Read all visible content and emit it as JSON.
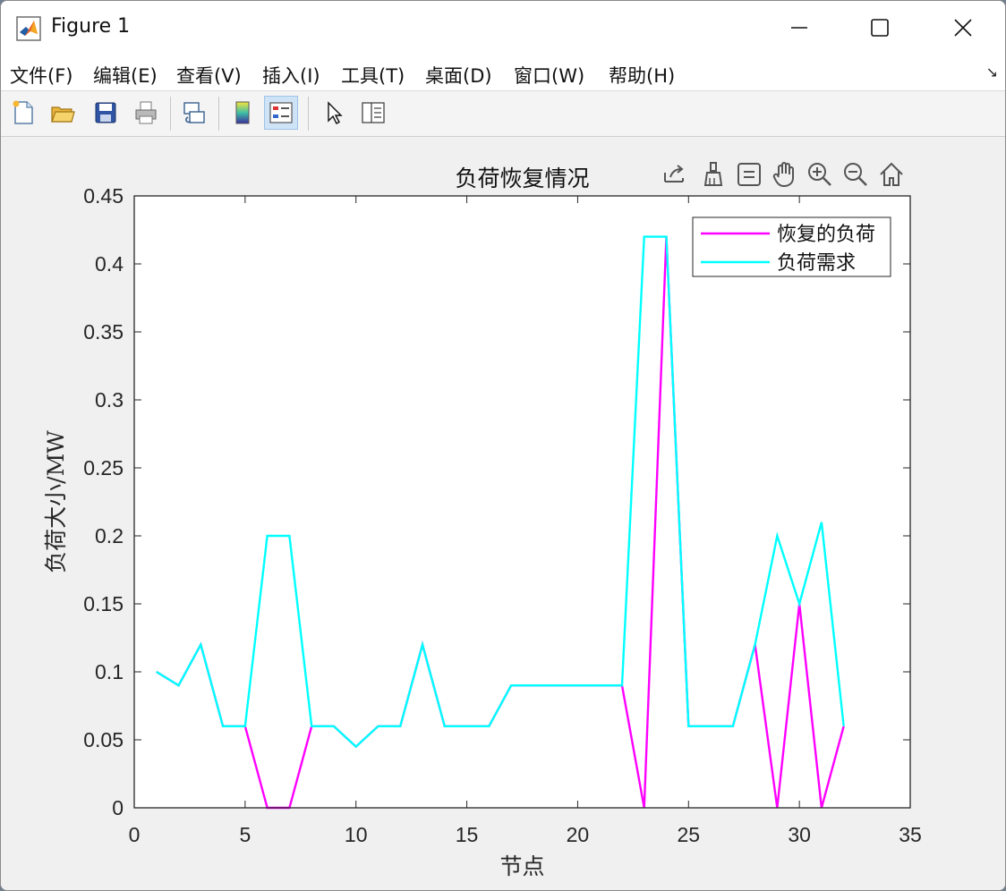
{
  "window": {
    "title": "Figure 1",
    "icon": "matlab-logo-icon"
  },
  "menu": {
    "items": [
      "文件(F)",
      "编辑(E)",
      "查看(V)",
      "插入(I)",
      "工具(T)",
      "桌面(D)",
      "窗口(W)",
      "帮助(H)"
    ],
    "overflow_glyph": "↘"
  },
  "toolbar": {
    "icons": [
      "new-figure-icon",
      "open-file-icon",
      "save-icon",
      "print-icon",
      "link-plot-icon",
      "insert-colorbar-icon",
      "insert-legend-icon",
      "edit-plot-arrow-icon",
      "property-inspector-icon"
    ],
    "active": "insert-legend-icon"
  },
  "axes_toolbar": {
    "icons": [
      "export-icon",
      "brush-icon",
      "data-tips-icon",
      "pan-icon",
      "zoom-in-icon",
      "zoom-out-icon",
      "home-icon"
    ]
  },
  "colors": {
    "restored": "#ff00ff",
    "demand": "#00ffff"
  },
  "chart_data": {
    "type": "line",
    "title": "负荷恢复情况",
    "xlabel": "节点",
    "ylabel": "负荷大小/MW",
    "xlim": [
      0,
      35
    ],
    "ylim": [
      0,
      0.45
    ],
    "xticks": [
      "0",
      "5",
      "10",
      "15",
      "20",
      "25",
      "30",
      "35"
    ],
    "yticks": [
      "0",
      "0.05",
      "0.1",
      "0.15",
      "0.2",
      "0.25",
      "0.3",
      "0.35",
      "0.4",
      "0.45"
    ],
    "legend_position": "top-right",
    "x": [
      1,
      2,
      3,
      4,
      5,
      6,
      7,
      8,
      9,
      10,
      11,
      12,
      13,
      14,
      15,
      16,
      17,
      18,
      19,
      20,
      21,
      22,
      23,
      24,
      25,
      26,
      27,
      28,
      29,
      30,
      31,
      32
    ],
    "series": [
      {
        "name": "恢复的负荷",
        "color": "#ff00ff",
        "values": [
          0.1,
          0.09,
          0.12,
          0.06,
          0.06,
          0,
          0,
          0.06,
          0.06,
          0.045,
          0.06,
          0.06,
          0.12,
          0.06,
          0.06,
          0.06,
          0.09,
          0.09,
          0.09,
          0.09,
          0.09,
          0.09,
          0,
          0.42,
          0.06,
          0.06,
          0.06,
          0.12,
          0,
          0.15,
          0,
          0.06
        ]
      },
      {
        "name": "负荷需求",
        "color": "#00ffff",
        "values": [
          0.1,
          0.09,
          0.12,
          0.06,
          0.06,
          0.2,
          0.2,
          0.06,
          0.06,
          0.045,
          0.06,
          0.06,
          0.12,
          0.06,
          0.06,
          0.06,
          0.09,
          0.09,
          0.09,
          0.09,
          0.09,
          0.09,
          0.42,
          0.42,
          0.06,
          0.06,
          0.06,
          0.12,
          0.2,
          0.15,
          0.21,
          0.06
        ]
      }
    ]
  }
}
